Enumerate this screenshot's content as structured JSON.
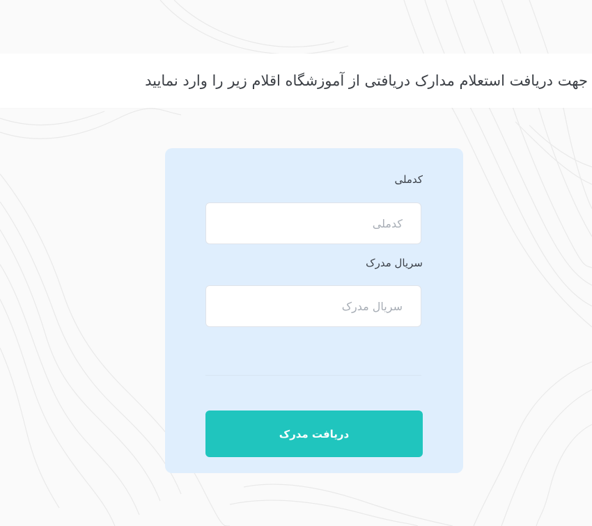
{
  "header": {
    "instruction": "جهت دریافت استعلام مدارک دریافتی از آموزشگاه اقلام زیر را وارد نمایید"
  },
  "form": {
    "national_id_label": "کدملی",
    "national_id_placeholder": "کدملی",
    "national_id_value": "",
    "serial_label": "سریال مدرک",
    "serial_placeholder": "سریال مدرک",
    "serial_value": "",
    "submit_label": "دریافت مدرک"
  },
  "colors": {
    "card_background": "#dfeefd",
    "button_background": "#20c5be",
    "page_background": "#fafafa"
  },
  "icons": [
    "topographic-background-pattern"
  ]
}
